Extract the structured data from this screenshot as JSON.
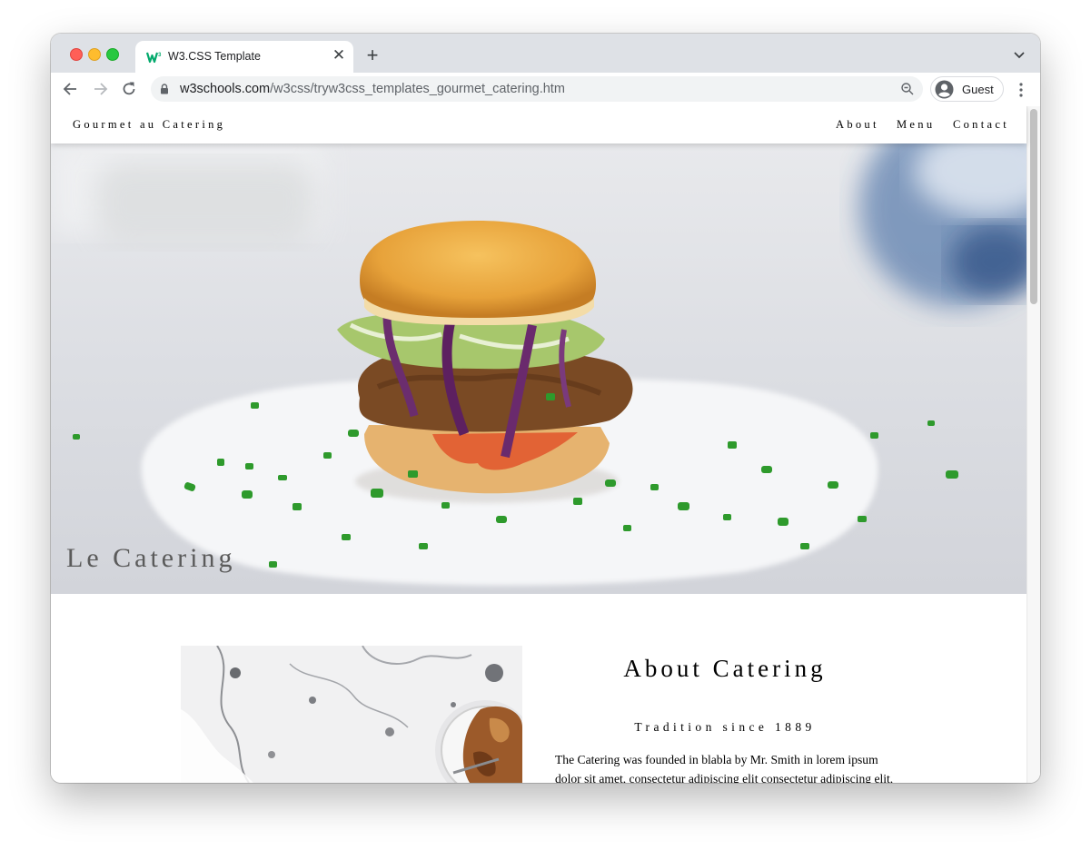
{
  "browser": {
    "tab": {
      "title": "W3.CSS Template",
      "close_glyph": "✕",
      "icon": "w3schools-favicon"
    },
    "new_tab_glyph": "+",
    "url": {
      "host": "w3schools.com",
      "path": "/w3css/tryw3css_templates_gourmet_catering.htm"
    },
    "profile_label": "Guest",
    "colors": {
      "tabbar": "#dee1e6",
      "omnibox": "#f1f3f4"
    }
  },
  "site": {
    "brand": "Gourmet au Catering",
    "nav": [
      {
        "label": "About"
      },
      {
        "label": "Menu"
      },
      {
        "label": "Contact"
      }
    ],
    "hero": {
      "title": "Le Catering",
      "image": "burger-on-plate-photo"
    },
    "about": {
      "title": "About Catering",
      "subtitle": "Tradition since 1889",
      "text": "The Catering was founded in blabla by Mr. Smith in lorem ipsum dolor sit amet, consectetur adipiscing elit consectetur adipiscing elit,",
      "image": "marble-table-food-photo"
    }
  }
}
